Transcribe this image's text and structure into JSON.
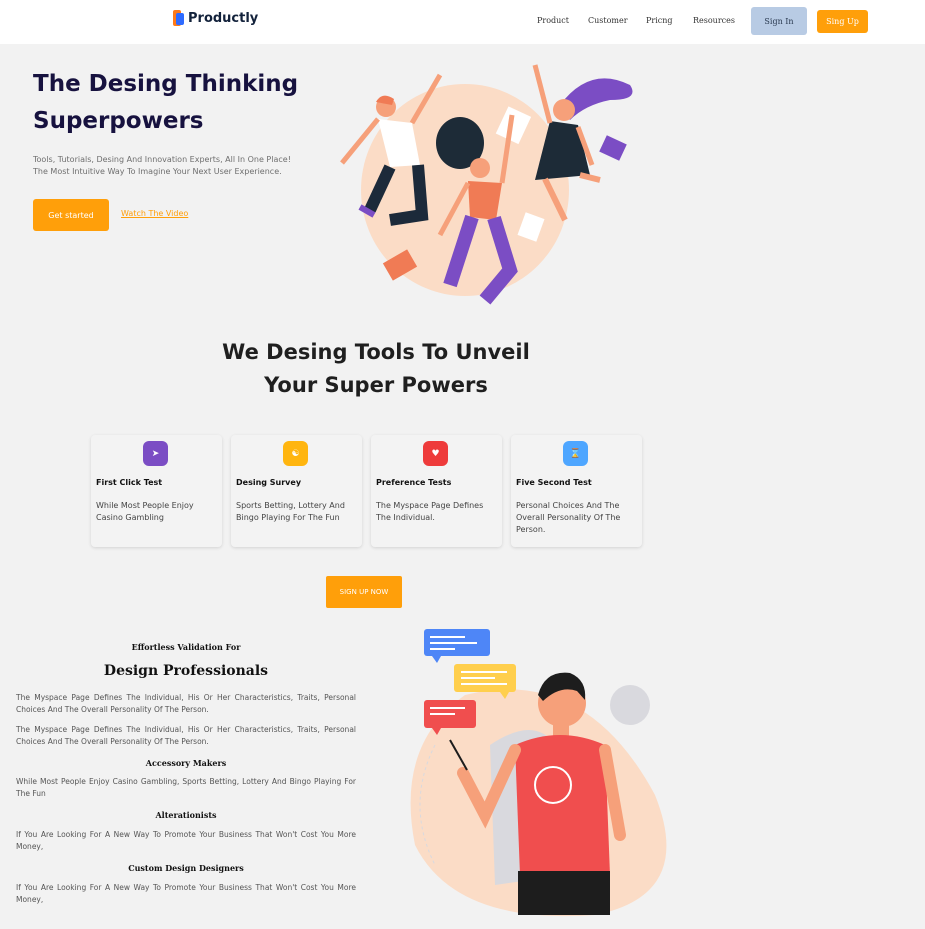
{
  "nav": {
    "brand": "Productly",
    "links": [
      "Product",
      "Customer",
      "Pricng",
      "Resources"
    ],
    "signin_label": "Sign In",
    "signup_label": "Sing Up"
  },
  "hero": {
    "title_line1": "The Desing Thinking",
    "title_line2": "Superpowers",
    "subtitle_line1": "Tools, Tutorials, Desing And Innovation Experts, All In One Place!",
    "subtitle_line2": "The Most Intuitive Way To Imagine Your Next User Experience.",
    "cta_label": "Get started",
    "video_link": "Watch The Video"
  },
  "tools": {
    "title_line1": "We Desing Tools To Unveil",
    "title_line2": "Your Super Powers",
    "cards": [
      {
        "title": "First Click Test",
        "text": "While Most People Enjoy Casino Gambling",
        "icon": "cursor-icon",
        "color": "#7b4dc4"
      },
      {
        "title": "Desing Survey",
        "text": "Sports Betting, Lottery And Bingo Playing For The Fun",
        "icon": "survey-icon",
        "color": "#ffb50f"
      },
      {
        "title": "Preference Tests",
        "text": "The Myspace Page Defines The Individual.",
        "icon": "heart-icon",
        "color": "#ee3b3b"
      },
      {
        "title": "Five Second Test",
        "text": "Personal Choices And The Overall Personality Of The Person.",
        "icon": "hourglass-icon",
        "color": "#4ea6ff"
      }
    ],
    "cta_label": "SIGN UP NOW"
  },
  "validation": {
    "eyebrow": "Effortless Validation For",
    "title": "Design Professionals",
    "para1": "The Myspace Page Defines The Individual, His Or Her Characteristics, Traits, Personal Choices And The Overall Personality Of The Person.",
    "para2": "The Myspace Page Defines The Individual, His Or Her Characteristics, Traits, Personal Choices And The Overall Personality Of The Person.",
    "sections": [
      {
        "heading": "Accessory Makers",
        "text": "While Most People Enjoy Casino Gambling, Sports Betting, Lottery And Bingo Playing For The Fun"
      },
      {
        "heading": "Alterationists",
        "text": "If You Are Looking For A New Way To Promote Your Business That Won't Cost You More Money,"
      },
      {
        "heading": "Custom Design Designers",
        "text": "If You Are Looking For A New Way To Promote Your Business That Won't Cost You More Money,"
      }
    ]
  },
  "colors": {
    "accent": "#ff9f0a",
    "navy": "#17123f",
    "signin_bg": "#b8cbe4"
  }
}
